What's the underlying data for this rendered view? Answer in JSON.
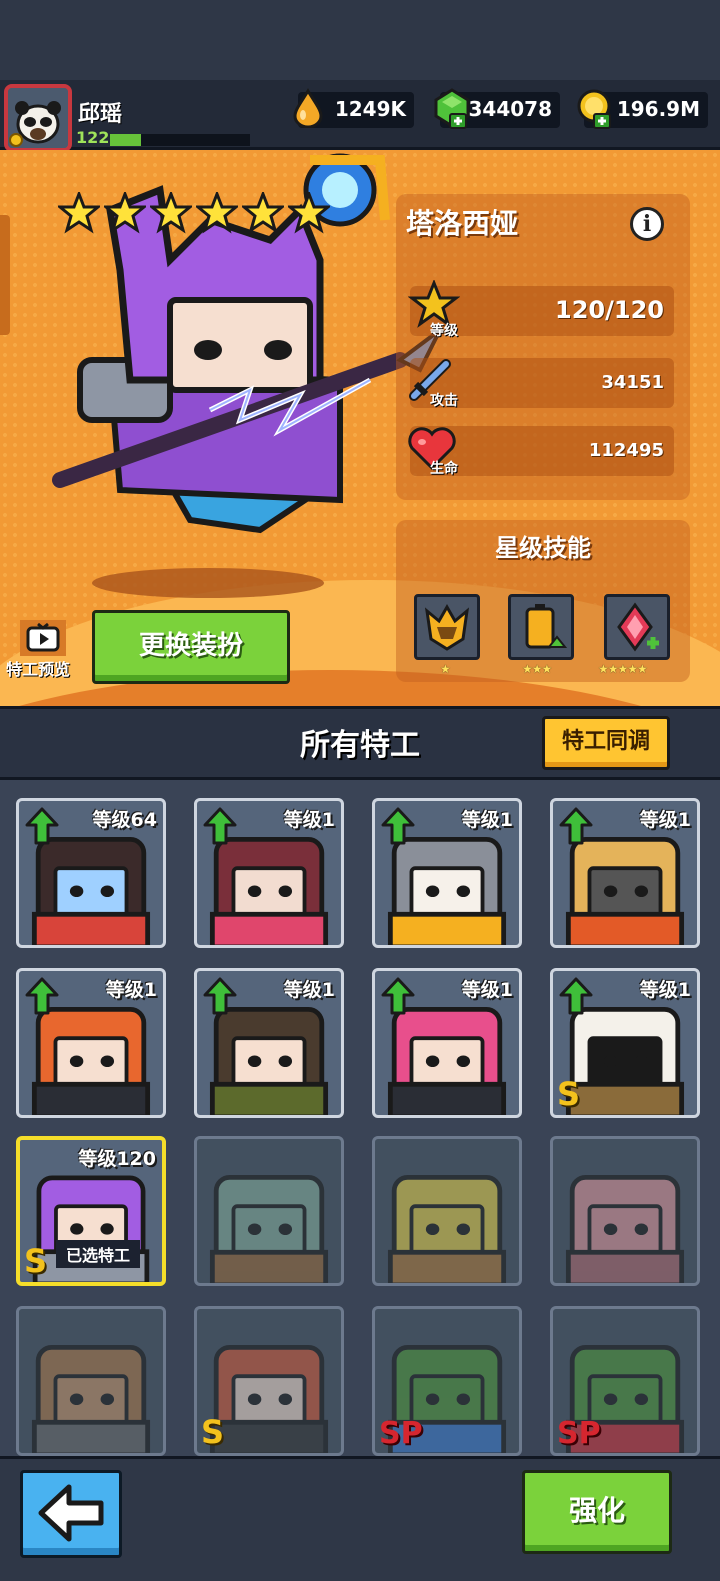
{
  "player": {
    "name": "邱瑶",
    "level": "122",
    "xp_fraction": 0.22
  },
  "resources": [
    {
      "icon": "water-drop-icon",
      "value": "1249K"
    },
    {
      "icon": "green-gem-plus-icon",
      "value": "344078"
    },
    {
      "icon": "gold-coin-plus-icon",
      "value": "196.9M"
    }
  ],
  "hero": {
    "name": "塔洛西娅",
    "star_count": 6,
    "stats": [
      {
        "label": "等级",
        "value": "120/120",
        "icon": "level-star-icon"
      },
      {
        "label": "攻击",
        "value": "34151",
        "icon": "sword-icon"
      },
      {
        "label": "生命",
        "value": "112495",
        "icon": "heart-icon"
      }
    ],
    "skills_title": "星级技能",
    "skills": [
      {
        "icon": "helmet-skill-icon",
        "stars": "★"
      },
      {
        "icon": "battery-up-skill-icon",
        "stars": "★★★"
      },
      {
        "icon": "gem-heal-skill-icon",
        "stars": "★★★★★"
      }
    ],
    "preview_label": "特工预览",
    "outfit_button": "更换装扮"
  },
  "agents": {
    "title": "所有特工",
    "sync_button": "特工同调",
    "cards": [
      {
        "level": "等级64",
        "upgrade": true,
        "rank": "",
        "locked": false
      },
      {
        "level": "等级1",
        "upgrade": true,
        "rank": "",
        "locked": false
      },
      {
        "level": "等级1",
        "upgrade": true,
        "rank": "",
        "locked": false
      },
      {
        "level": "等级1",
        "upgrade": true,
        "rank": "",
        "locked": false
      },
      {
        "level": "等级1",
        "upgrade": true,
        "rank": "",
        "locked": false
      },
      {
        "level": "等级1",
        "upgrade": true,
        "rank": "",
        "locked": false
      },
      {
        "level": "等级1",
        "upgrade": true,
        "rank": "",
        "locked": false
      },
      {
        "level": "等级1",
        "upgrade": true,
        "rank": "S",
        "locked": false
      },
      {
        "level": "等级120",
        "upgrade": false,
        "rank": "S",
        "locked": false,
        "selected_label": "已选特工"
      },
      {
        "level": "",
        "upgrade": false,
        "rank": "",
        "locked": true
      },
      {
        "level": "",
        "upgrade": false,
        "rank": "",
        "locked": true
      },
      {
        "level": "",
        "upgrade": false,
        "rank": "",
        "locked": true
      },
      {
        "level": "",
        "upgrade": false,
        "rank": "",
        "locked": true
      },
      {
        "level": "",
        "upgrade": false,
        "rank": "S",
        "locked": true
      },
      {
        "level": "",
        "upgrade": false,
        "rank": "SP",
        "locked": true
      },
      {
        "level": "",
        "upgrade": false,
        "rank": "SP",
        "locked": true
      }
    ]
  },
  "bottom": {
    "back_icon": "back-arrow-icon",
    "enhance_button": "强化"
  },
  "colors": {
    "hero_bg": "#f29a35",
    "green_button": "#7bd23b",
    "sync_button": "#ffc531",
    "selected_border": "#f5de2a"
  }
}
